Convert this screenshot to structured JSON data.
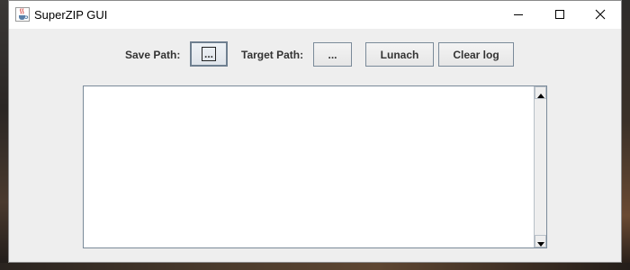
{
  "window": {
    "title": "SuperZIP GUI",
    "app_icon": "java-cup-icon"
  },
  "window_controls": {
    "minimize_icon": "minimize-icon",
    "maximize_icon": "maximize-icon",
    "close_icon": "close-icon"
  },
  "toolbar": {
    "save_path_label": "Save Path:",
    "save_path_button": "...",
    "target_path_label": "Target Path:",
    "target_path_button": "...",
    "launch_button": "Lunach",
    "clear_log_button": "Clear log"
  },
  "log": {
    "value": ""
  },
  "colors": {
    "window_background": "#eeeeee",
    "titlebar_background": "#ffffff",
    "button_border": "#7a8a99",
    "label_text": "#333333"
  }
}
